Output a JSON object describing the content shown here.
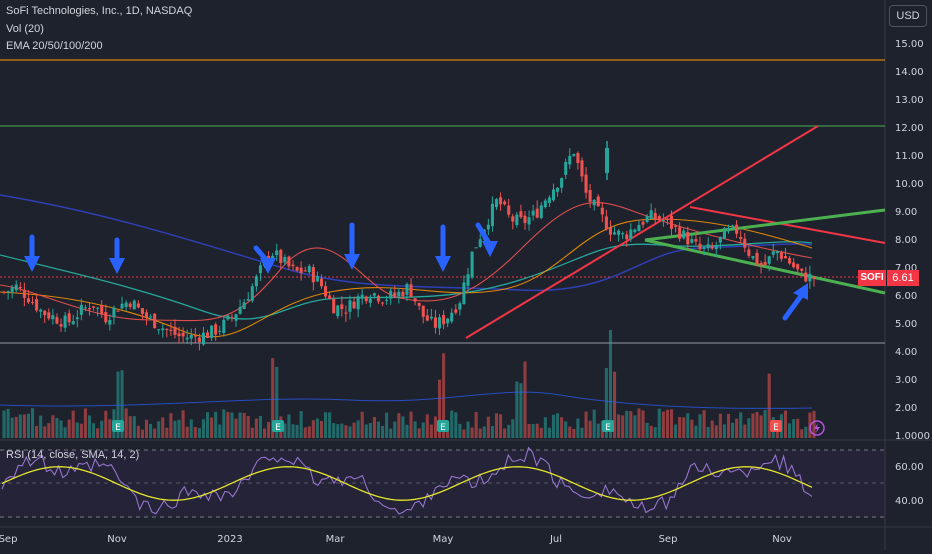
{
  "header": {
    "title": "SoFi Technologies, Inc., 1D, NASDAQ",
    "vol_label": "Vol (20)",
    "ema_label": "EMA 20/50/100/200",
    "currency": "USD"
  },
  "price_axis": [
    "15.00",
    "14.00",
    "13.00",
    "12.00",
    "11.00",
    "10.00",
    "9.00",
    "8.00",
    "7.00",
    "6.00",
    "5.00",
    "4.00",
    "3.00",
    "2.00",
    "1.0000"
  ],
  "rsi": {
    "label": "RSI (14, close, SMA, 14, 2)",
    "axis": [
      "60.00",
      "40.00"
    ],
    "overbought": 70,
    "oversold": 30
  },
  "time_axis": [
    "Sep",
    "Nov",
    "2023",
    "Mar",
    "May",
    "Jul",
    "Sep",
    "Nov"
  ],
  "symbol_tag": {
    "symbol": "SOFI",
    "price": "6.61"
  },
  "earnings_marker": "E",
  "colors": {
    "background": "#1e222d",
    "up": "#26a69a",
    "down": "#ef5350",
    "arrow": "#2962ff",
    "support_line": "#f23645",
    "resistance_green": "#4caf50",
    "orange_line": "#ff9800",
    "rsi_line": "#b39ddb",
    "rsi_ma": "#e6e62e"
  },
  "chart_data": {
    "type": "candlestick",
    "symbol": "SOFI",
    "interval": "1D",
    "exchange": "NASDAQ",
    "last_price": 6.61,
    "ylim": [
      3.5,
      15.5
    ],
    "horizontal_levels": [
      {
        "value": 14.45,
        "color": "#ff9800"
      },
      {
        "value": 12.05,
        "color": "#4caf50"
      },
      {
        "value": 6.61,
        "color": "#f23645",
        "style": "dotted"
      },
      {
        "value": 4.3,
        "color": "#9598a1"
      }
    ],
    "trend_lines": [
      {
        "color": "#f23645",
        "from": [
          "May",
          4.5
        ],
        "to": [
          "Nov+",
          12.0
        ]
      },
      {
        "color": "#f23645",
        "from": [
          "Sep",
          9.2
        ],
        "to": [
          "end",
          7.8
        ]
      },
      {
        "color": "#4caf50",
        "from": [
          "Aug",
          7.9
        ],
        "to": [
          "end",
          9.05
        ]
      },
      {
        "color": "#4caf50",
        "from": [
          "Aug",
          7.9
        ],
        "to": [
          "end",
          6.05
        ]
      }
    ],
    "candles_close_approx": [
      6.1,
      6.3,
      5.9,
      5.4,
      5.2,
      5.0,
      5.4,
      5.7,
      5.2,
      5.6,
      5.8,
      5.3,
      5.0,
      4.7,
      4.5,
      4.5,
      4.6,
      4.8,
      5.2,
      5.8,
      6.6,
      7.6,
      7.2,
      6.8,
      6.9,
      6.4,
      5.6,
      5.5,
      5.9,
      6.1,
      5.9,
      6.0,
      6.3,
      5.3,
      4.9,
      5.2,
      5.8,
      7.5,
      8.5,
      9.4,
      8.7,
      8.6,
      8.9,
      9.6,
      10.2,
      11.2,
      9.6,
      8.9,
      8.3,
      8.1,
      8.5,
      8.8,
      8.7,
      8.4,
      8.0,
      7.6,
      7.6,
      8.2,
      8.3,
      7.4,
      7.0,
      7.6,
      7.2,
      6.7,
      6.61
    ]
  }
}
